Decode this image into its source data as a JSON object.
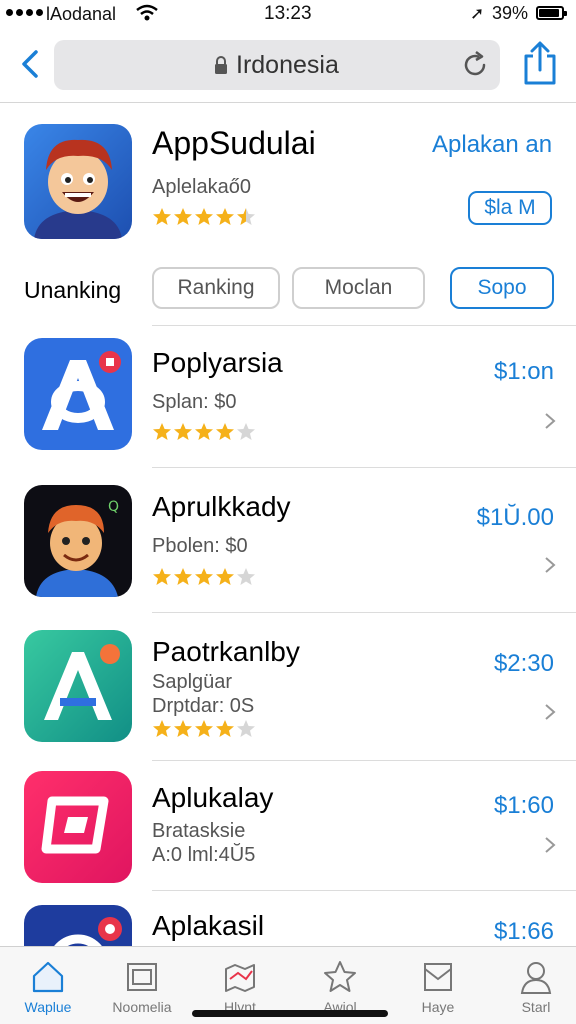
{
  "status": {
    "carrier": "lAodanal",
    "time": "13:23",
    "battery": "39%"
  },
  "browser": {
    "url": "Irdonesia"
  },
  "featured": {
    "title": "AppSudulai",
    "subtitle": "Aplelakaő0",
    "rating": 4.5,
    "action": "Aplakan an",
    "price": "$la M"
  },
  "filters": {
    "label": "Unanking",
    "chips": [
      "Ranking",
      "Moclan",
      "Sopo"
    ],
    "active_index": 2
  },
  "apps": [
    {
      "title": "Poplyarsia",
      "sub1": "Splan: $0",
      "sub2": "",
      "price": "$1:on",
      "rating": 4
    },
    {
      "title": "Aprulkkady",
      "sub1": "Pbolen: $0",
      "sub2": "",
      "price": "$1Ŭ.00",
      "rating": 4
    },
    {
      "title": "Paotrkanlby",
      "sub1": "Saplgüar",
      "sub2": "Drptdar: 0S",
      "price": "$2:30",
      "rating": 4
    },
    {
      "title": "Aplukalay",
      "sub1": "Bratasksie",
      "sub2": "A:0 lml:4Ŭ5",
      "price": "$1:60",
      "rating": 0
    },
    {
      "title": "Aplakasil",
      "sub1": "",
      "sub2": "",
      "price": "$1:66",
      "rating": 0
    }
  ],
  "tabs": [
    {
      "label": "Waplue",
      "icon": "home-icon"
    },
    {
      "label": "Noomelia",
      "icon": "photo-icon"
    },
    {
      "label": "Hlvnt",
      "icon": "map-icon"
    },
    {
      "label": "Awiol",
      "icon": "star-icon"
    },
    {
      "label": "Haye",
      "icon": "inbox-icon"
    },
    {
      "label": "Starl",
      "icon": "person-icon"
    }
  ],
  "colors": {
    "accent": "#1a7fd6",
    "star": "#f5b11a",
    "star_empty": "#d6d6d6"
  }
}
